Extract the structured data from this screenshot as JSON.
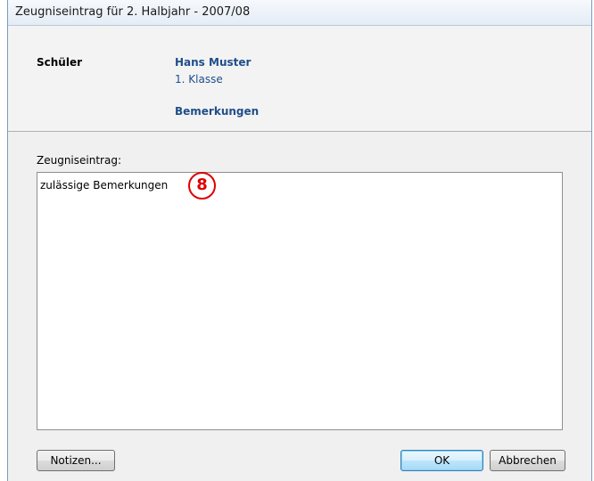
{
  "window": {
    "title": "Zeugniseintrag für 2. Halbjahr - 2007/08"
  },
  "header": {
    "student_label": "Schüler",
    "student_name": "Hans Muster",
    "student_class": "1. Klasse",
    "section_title": "Bemerkungen"
  },
  "entry": {
    "label": "Zeugniseintrag:",
    "value": "zulässige Bemerkungen"
  },
  "annotation": {
    "marker_number": "8",
    "marker_color": "#e00000"
  },
  "buttons": {
    "notes": "Notizen...",
    "ok": "OK",
    "cancel": "Abbrechen"
  },
  "colors": {
    "accent_text": "#1f4e8a",
    "marker": "#e00000"
  }
}
